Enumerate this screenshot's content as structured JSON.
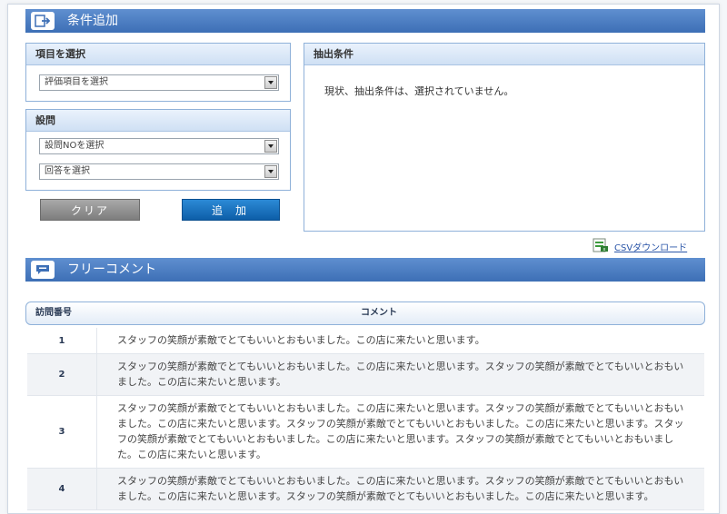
{
  "condition_section": {
    "title": "条件追加"
  },
  "item_panel": {
    "title": "項目を選択",
    "select_value": "評価項目を選択"
  },
  "question_panel": {
    "title": "設問",
    "question_select_value": "設問NOを選択",
    "answer_select_value": "回答を選択"
  },
  "buttons": {
    "clear": "クリア",
    "add": "追加"
  },
  "extract_panel": {
    "title": "抽出条件",
    "message": "現状、抽出条件は、選択されていません。"
  },
  "csv": {
    "label": "CSVダウンロード"
  },
  "comment_section": {
    "title": "フリーコメント"
  },
  "comment_table": {
    "headers": {
      "number": "訪問番号",
      "comment": "コメント"
    },
    "rows": [
      {
        "number": "1",
        "comment": "スタッフの笑顔が素敵でとてもいいとおもいました。この店に来たいと思います。"
      },
      {
        "number": "2",
        "comment": "スタッフの笑顔が素敵でとてもいいとおもいました。この店に来たいと思います。スタッフの笑顔が素敵でとてもいいとおもいました。この店に来たいと思います。"
      },
      {
        "number": "3",
        "comment": "スタッフの笑顔が素敵でとてもいいとおもいました。この店に来たいと思います。スタッフの笑顔が素敵でとてもいいとおもいました。この店に来たいと思います。スタッフの笑顔が素敵でとてもいいとおもいました。この店に来たいと思います。スタッフの笑顔が素敵でとてもいいとおもいました。この店に来たいと思います。スタッフの笑顔が素敵でとてもいいとおもいました。この店に来たいと思います。"
      },
      {
        "number": "4",
        "comment": "スタッフの笑顔が素敵でとてもいいとおもいました。この店に来たいと思います。スタッフの笑顔が素敵でとてもいいとおもいました。この店に来たいと思います。スタッフの笑顔が素敵でとてもいいとおもいました。この店に来たいと思います。"
      }
    ]
  },
  "colors": {
    "header_blue": "#3d6fb6",
    "link": "#2a55a8",
    "add_button": "#0d5ea8",
    "clear_button": "#7d7d7d"
  }
}
